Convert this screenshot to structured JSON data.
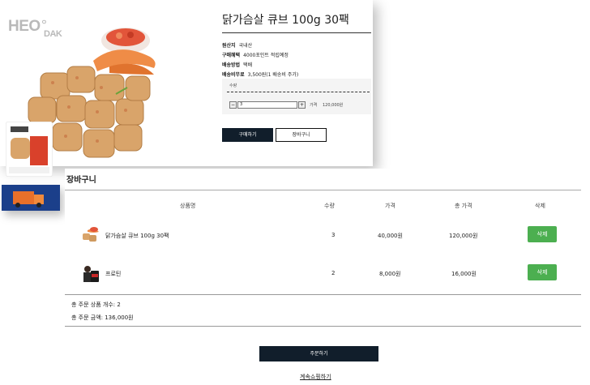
{
  "product_page": {
    "logo": "HEO",
    "logo_suffix": "ㅇ",
    "logo_sub": "DAK",
    "title": "닭가슴살 큐브 100g 30팩",
    "specs": [
      {
        "key": "원산지",
        "value": "국내산"
      },
      {
        "key": "구매혜택",
        "value": "4000포인트 적립예정"
      },
      {
        "key": "배송방법",
        "value": "택배"
      },
      {
        "key": "배송비무료",
        "value": "3,500원(1 배송비 주가)"
      }
    ],
    "option_label": "수량",
    "quantity": "3",
    "price_label": "가격",
    "price_value": "120,000원",
    "minus": "−",
    "plus": "+",
    "buy_label": "구매하기",
    "cart_label": "장바구니"
  },
  "cart": {
    "title": "장바구니",
    "headers": {
      "name": "상품명",
      "qty": "수량",
      "price": "가격",
      "total": "총 가격",
      "delete": "삭제"
    },
    "items": [
      {
        "name": "닭가슴살 큐브 100g 30팩",
        "qty": "3",
        "price": "40,000원",
        "total": "120,000원",
        "delete": "삭제"
      },
      {
        "name": "프로틴",
        "qty": "2",
        "price": "8,000원",
        "total": "16,000원",
        "delete": "삭제"
      }
    ],
    "summary_count": "총 주문 상품 개수: 2",
    "summary_amount": "총 주문 금액: 136,000원",
    "order_label": "주문하기",
    "continue_label": "계속쇼핑하기"
  },
  "colors": {
    "primary_dark": "#111e2b",
    "delete_green": "#4caf50"
  },
  "icons": [
    "chicken-cube-product-image",
    "protein-product-image"
  ]
}
